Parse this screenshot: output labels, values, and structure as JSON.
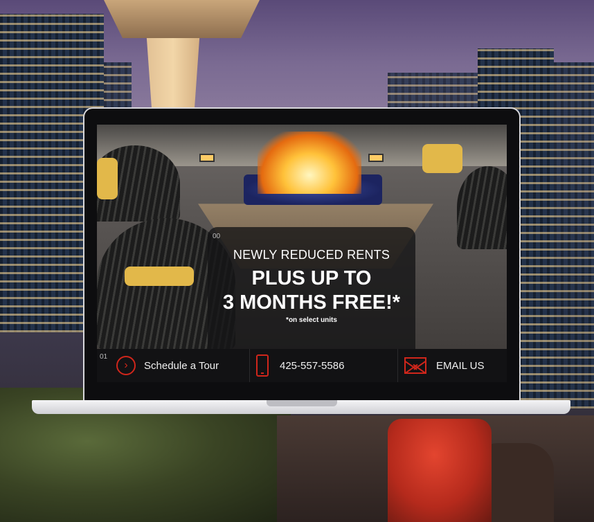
{
  "promo": {
    "slide_index": "00",
    "headline": "NEWLY REDUCED RENTS",
    "offer_line1": "PLUS UP TO",
    "offer_line2": "3 MONTHS FREE!*",
    "footnote": "*on select units"
  },
  "action_bar": {
    "slide_index": "01",
    "tour_label": "Schedule a Tour",
    "phone_number": "425-557-5586",
    "email_label": "EMAIL US",
    "icons": {
      "tour": "chevron-right-circle-icon",
      "phone": "phone-icon",
      "email": "envelope-icon"
    }
  },
  "colors": {
    "accent_red": "#d0261b",
    "bar_background": "#121214"
  }
}
